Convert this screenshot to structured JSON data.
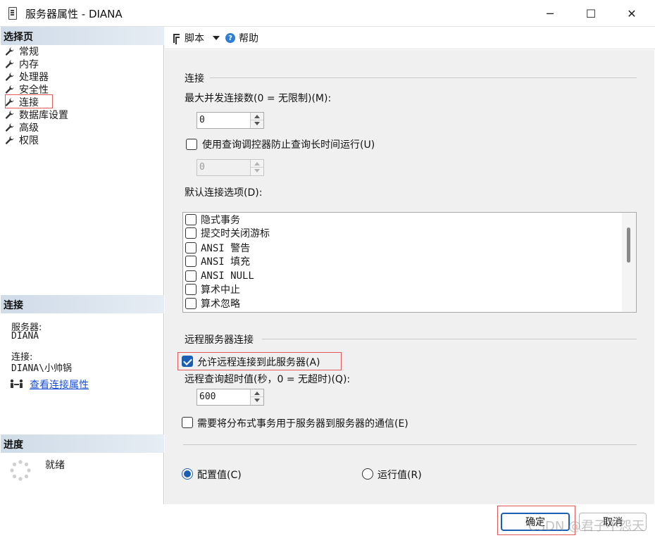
{
  "window": {
    "title": "服务器属性 - DIANA",
    "min_glyph": "─",
    "max_glyph": "☐",
    "close_glyph": "✕"
  },
  "left": {
    "select_page_header": "选择页",
    "nav_items": [
      {
        "label": "常规",
        "icon": "wrench-icon"
      },
      {
        "label": "内存",
        "icon": "wrench-icon"
      },
      {
        "label": "处理器",
        "icon": "wrench-icon"
      },
      {
        "label": "安全性",
        "icon": "wrench-icon"
      },
      {
        "label": "连接",
        "icon": "wrench-icon",
        "selected": true
      },
      {
        "label": "数据库设置",
        "icon": "wrench-icon"
      },
      {
        "label": "高级",
        "icon": "wrench-icon"
      },
      {
        "label": "权限",
        "icon": "wrench-icon"
      }
    ],
    "connection_header": "连接",
    "server_label": "服务器:",
    "server_value": "DIANA",
    "connection_label": "连接:",
    "connection_value": "DIANA\\小帅锅",
    "view_conn_link": "查看连接属性",
    "progress_header": "进度",
    "status": "就绪"
  },
  "toolbar": {
    "script_label": "脚本",
    "help_label": "帮助",
    "help_glyph": "?"
  },
  "main": {
    "conn_group_title": "连接",
    "max_conn_label": "最大并发连接数(0 = 无限制)(M):",
    "max_conn_value": "0",
    "query_governor_label": "使用查询调控器防止查询长时间运行(U)",
    "query_governor_checked": false,
    "query_governor_value": "0",
    "default_opts_label": "默认连接选项(D):",
    "default_opts": [
      {
        "label": "隐式事务",
        "checked": false
      },
      {
        "label": "提交时关闭游标",
        "checked": false
      },
      {
        "label": "ANSI 警告",
        "checked": false
      },
      {
        "label": "ANSI 填充",
        "checked": false
      },
      {
        "label": "ANSI NULL",
        "checked": false
      },
      {
        "label": "算术中止",
        "checked": false
      },
      {
        "label": "算术忽略",
        "checked": false
      }
    ],
    "remote_group_title": "远程服务器连接",
    "allow_remote_label": "允许远程连接到此服务器(A)",
    "allow_remote_checked": true,
    "remote_timeout_label": "远程查询超时值(秒，0 = 无超时)(Q):",
    "remote_timeout_value": "600",
    "distributed_tx_label": "需要将分布式事务用于服务器到服务器的通信(E)",
    "distributed_tx_checked": false,
    "radio_configured_label": "配置值(C)",
    "radio_running_label": "运行值(R)",
    "selected_radio": "configured"
  },
  "buttons": {
    "ok_label": "确定",
    "cancel_label": "取消"
  },
  "watermark": "CSDN @君子不怨天"
}
